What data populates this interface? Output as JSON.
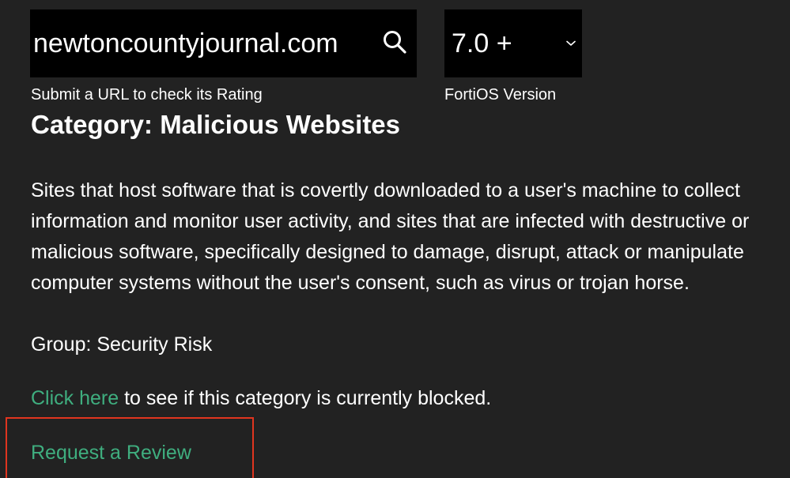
{
  "lookup": {
    "url_value": "newtoncountyjournal.com",
    "url_caption": "Submit a URL to check its Rating",
    "search_icon": "search-icon",
    "version_value": "7.0 +",
    "version_caption": "FortiOS Version",
    "version_icon": "chevron-down-icon"
  },
  "result": {
    "category_title": "Category: Malicious Websites",
    "description": "Sites that host software that is covertly downloaded to a user's machine to collect information and monitor user activity, and sites that are infected with destructive or malicious software, specifically designed to damage, disrupt, attack or manipulate computer systems without the user's consent, such as virus or trojan horse.",
    "group": "Group: Security Risk",
    "blocked_link": "Click here",
    "blocked_text": " to see if this category is currently blocked.",
    "review_link": "Request a Review"
  },
  "colors": {
    "background": "#222222",
    "input_background": "#000000",
    "link": "#3fae7f",
    "highlight_border": "#e0351f"
  }
}
